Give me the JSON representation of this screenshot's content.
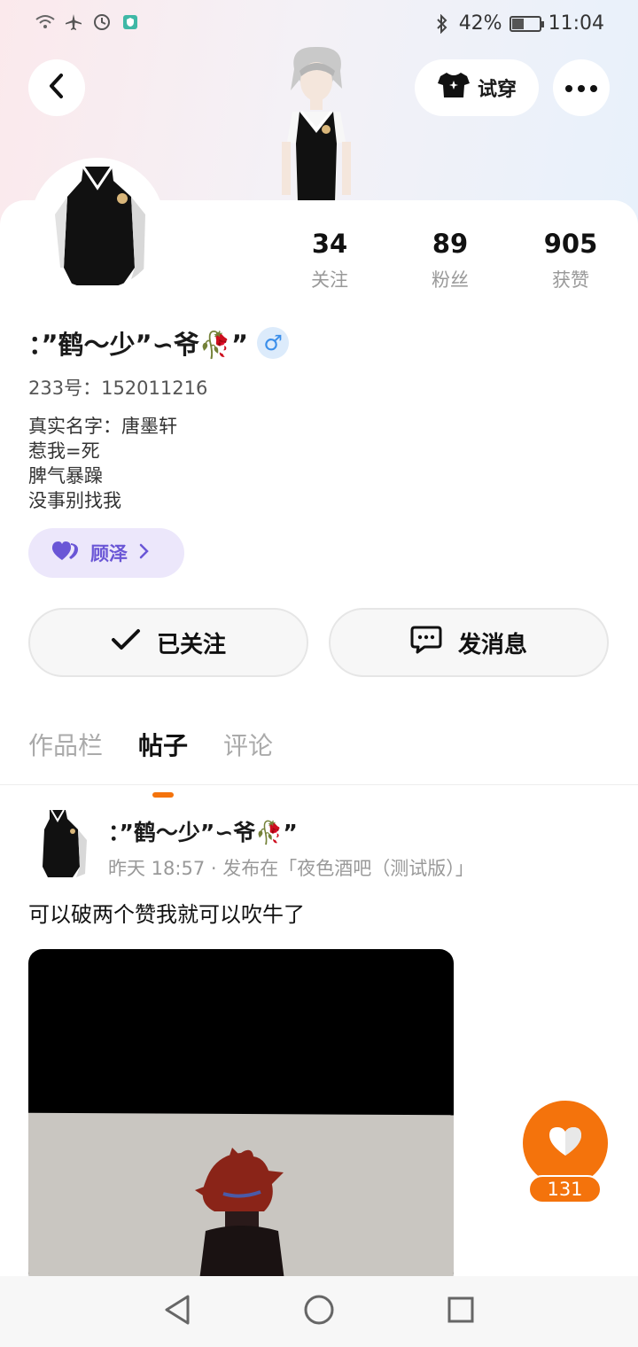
{
  "status_bar": {
    "left_icons": [
      "wifi-icon",
      "airplane-icon",
      "data-saver-icon",
      "shield-icon"
    ],
    "battery_percent": "42%",
    "time": "11:04",
    "bluetooth_icon": "bluetooth-icon"
  },
  "header": {
    "back_icon": "chevron-left-icon",
    "try_on_label": "试穿",
    "more_icon": "more-horizontal-icon"
  },
  "profile": {
    "stats": [
      {
        "num": "34",
        "label": "关注"
      },
      {
        "num": "89",
        "label": "粉丝"
      },
      {
        "num": "905",
        "label": "获赞"
      }
    ],
    "name": "：”鹤～少”∽爷🥀”",
    "gender_symbol": "♂",
    "uid": "233号：152011216",
    "bio_lines": [
      "真实名字：唐墨轩",
      "惹我=死",
      "脾气暴躁",
      "没事别找我"
    ],
    "guild_label": "顾泽"
  },
  "actions": {
    "follow_label": "已关注",
    "message_label": "发消息"
  },
  "tabs": [
    "作品栏",
    "帖子",
    "评论"
  ],
  "post": {
    "author": "：”鹤～少”∽爷🥀”",
    "meta": "昨天 18:57 · 发布在「夜色酒吧（测试版）」",
    "text": "可以破两个赞我就可以吹牛了",
    "likes": "131"
  },
  "colors": {
    "accent": "#f4730c",
    "guild_text": "#6a56d6",
    "guild_bg": "#ece7fb",
    "gender": "#3a8eea"
  }
}
